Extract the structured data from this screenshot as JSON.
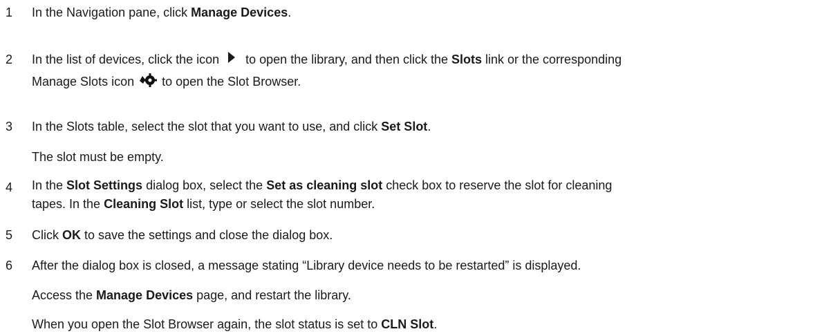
{
  "steps": [
    {
      "num": "1",
      "parts": [
        "In the Navigation pane, click ",
        "Manage Devices",
        "."
      ]
    },
    {
      "num": "2",
      "parts": [
        "In the list of devices, click the icon ",
        " to open the library, and then click the ",
        "Slots",
        " link or the corresponding",
        "Manage Slots icon ",
        " to open the Slot Browser."
      ],
      "icon1": "play-arrow-icon",
      "icon2": "manage-slots-gear-icon"
    },
    {
      "num": "3",
      "parts": [
        "In the Slots table, select the slot that you want to use, and click ",
        "Set Slot",
        "."
      ],
      "note": "The slot must be empty."
    },
    {
      "num": "4",
      "parts": [
        "In the ",
        "Slot Settings",
        " dialog box, select the ",
        "Set as cleaning slot",
        " check box to reserve the slot for cleaning",
        "tapes. In the ",
        "Cleaning Slot",
        " list, type or select the slot number."
      ]
    },
    {
      "num": "5",
      "parts": [
        "Click ",
        "OK",
        " to save the settings and close the dialog box."
      ]
    },
    {
      "num": "6",
      "parts": [
        "After the dialog box is closed, a message stating “Library device needs to be restarted” is displayed."
      ],
      "note1_parts": [
        "Access the ",
        "Manage Devices",
        " page, and restart the library."
      ],
      "note2_parts": [
        "When you open the Slot Browser again, the slot status is set to ",
        "CLN Slot",
        "."
      ]
    }
  ]
}
